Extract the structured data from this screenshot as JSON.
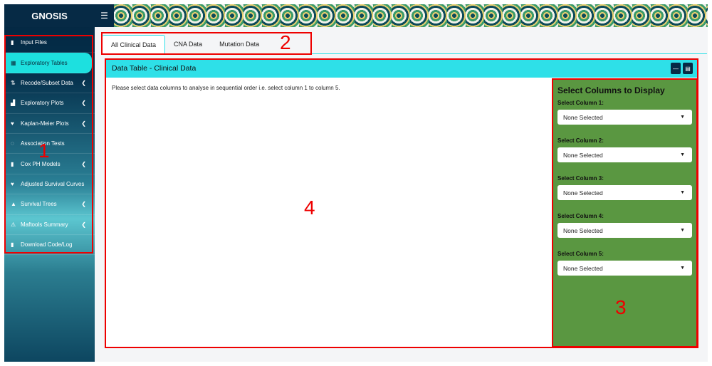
{
  "app": {
    "title": "GNOSIS",
    "menu_icon": "hamburger-icon"
  },
  "sidebar": {
    "items": [
      {
        "label": "Input Files",
        "icon": "file-icon",
        "ic": "▮",
        "chev": false
      },
      {
        "label": "Exploratory Tables",
        "icon": "table-icon",
        "ic": "▦",
        "chev": false,
        "active": true
      },
      {
        "label": "Recode/Subset Data",
        "icon": "sort-icon",
        "ic": "⇅",
        "chev": true
      },
      {
        "label": "Exploratory Plots",
        "icon": "chart-icon",
        "ic": "▟",
        "chev": true
      },
      {
        "label": "Kaplan-Meier Plots",
        "icon": "heart-icon",
        "ic": "♥",
        "chev": true
      },
      {
        "label": "Association Tests",
        "icon": "circle-icon",
        "ic": "◌",
        "chev": false
      },
      {
        "label": "Cox PH Models",
        "icon": "file-icon",
        "ic": "▮",
        "chev": true
      },
      {
        "label": "Adjusted Survival Curves",
        "icon": "heart-icon",
        "ic": "♥",
        "chev": false
      },
      {
        "label": "Survival Trees",
        "icon": "bell-icon",
        "ic": "▲",
        "chev": true
      },
      {
        "label": "Maftools Summary",
        "icon": "warning-icon",
        "ic": "⚠",
        "chev": true
      },
      {
        "label": "Download Code/Log",
        "icon": "file-icon",
        "ic": "▮",
        "chev": false
      }
    ]
  },
  "tabs": [
    {
      "label": "All Clinical Data",
      "active": true
    },
    {
      "label": "CNA Data"
    },
    {
      "label": "Mutation Data"
    }
  ],
  "box": {
    "title": "Data Table - Clinical Data",
    "note": "Please select data columns to analyse in sequential order i.e. select column 1 to column 5."
  },
  "panel": {
    "title": "Select Columns to Display",
    "selects": [
      {
        "label": "Select Column 1:",
        "value": "None Selected"
      },
      {
        "label": "Select Column 2:",
        "value": "None Selected"
      },
      {
        "label": "Select Column 3:",
        "value": "None Selected"
      },
      {
        "label": "Select Column 4:",
        "value": "None Selected"
      },
      {
        "label": "Select Column 5:",
        "value": "None Selected"
      }
    ]
  },
  "annotations": [
    "1",
    "2",
    "3",
    "4"
  ],
  "colors": {
    "accent": "#2ee0e8",
    "sidebar": "#062a45",
    "panel": "#5a9741",
    "annotation": "#e00000"
  }
}
